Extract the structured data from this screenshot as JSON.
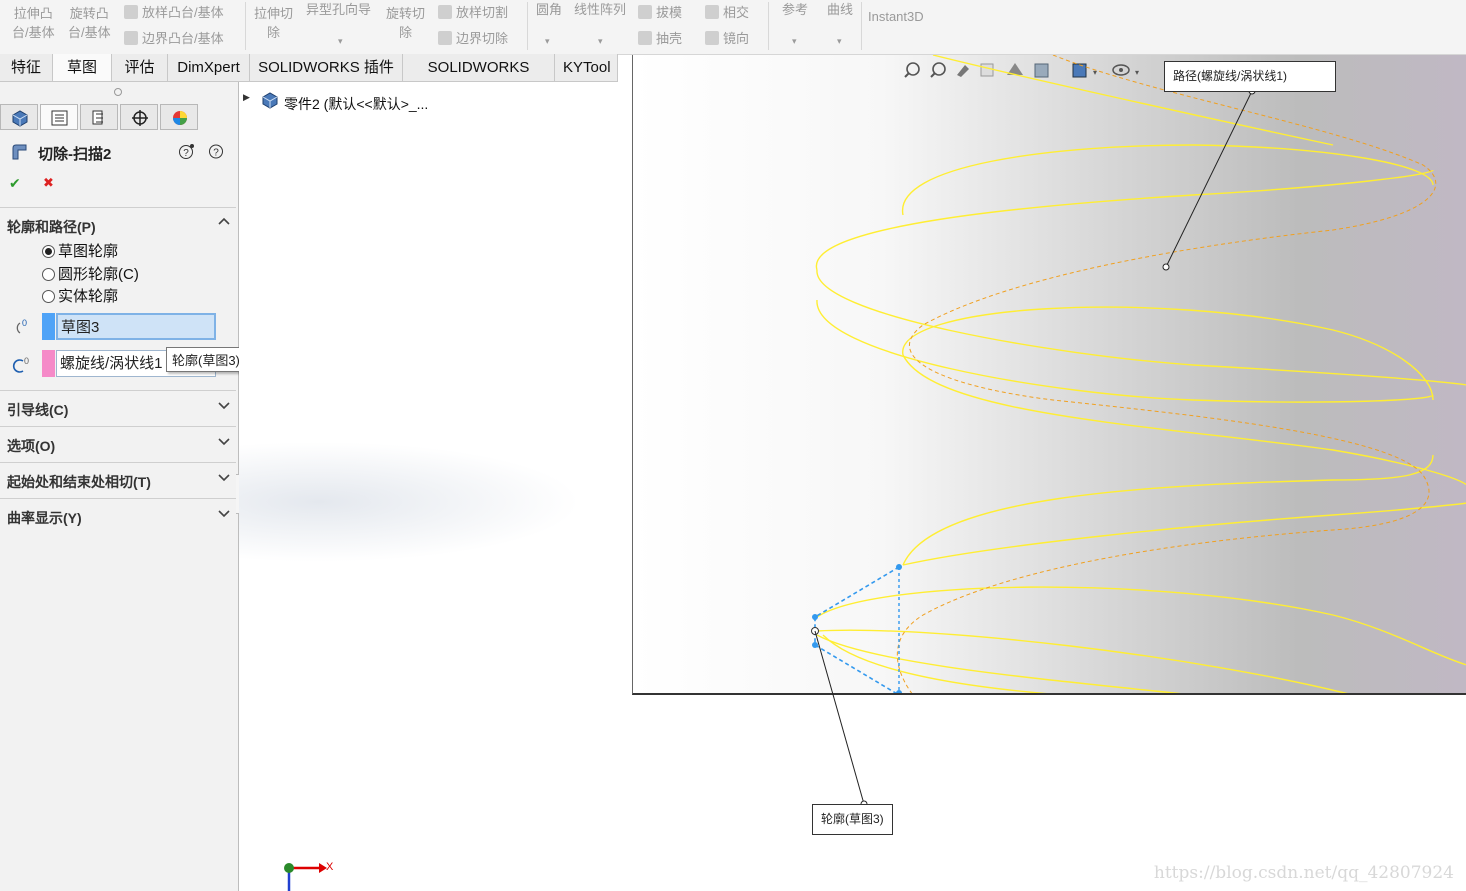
{
  "ribbon": {
    "extrude_boss_1": "拉伸凸",
    "extrude_boss_2": "台/基体",
    "revolve_boss_1": "旋转凸",
    "revolve_boss_2": "台/基体",
    "loft_boss": "放样凸台/基体",
    "boundary_boss": "边界凸台/基体",
    "extrude_cut_1": "拉伸切",
    "extrude_cut_2": "除",
    "hole_wizard": "异型孔向导",
    "revolve_cut_1": "旋转切",
    "revolve_cut_2": "除",
    "loft_cut": "放样切割",
    "boundary_cut": "边界切除",
    "fillet": "圆角",
    "linear_pattern": "线性阵列",
    "draft": "拔模",
    "shell": "抽壳",
    "intersect": "相交",
    "mirror": "镜向",
    "reference": "参考",
    "curves": "曲线",
    "instant3d": "Instant3D"
  },
  "tabs": [
    "特征",
    "草图",
    "评估",
    "DimXpert",
    "SOLIDWORKS 插件",
    "SOLIDWORKS MBD",
    "KYTool"
  ],
  "panel": {
    "feature_title": "切除-扫描2",
    "ok_symbol": "✔",
    "cancel_symbol": "✖",
    "section_profile_path": "轮廓和路径(P)",
    "radio_options": [
      "草图轮廓",
      "圆形轮廓(C)",
      "实体轮廓"
    ],
    "selected_radio": "草图轮廓",
    "profile_value": "草图3",
    "path_value": "螺旋线/涡状线1",
    "tooltip": "轮廓(草图3)",
    "collapsed_sections": [
      "引导线(C)",
      "选项(O)",
      "起始处和结束处相切(T)",
      "曲率显示(Y)"
    ]
  },
  "tree": {
    "root_label": "零件2 (默认<<默认>_..."
  },
  "viewport": {
    "callout_path": "路径(螺旋线/涡状线1)",
    "callout_profile": "轮廓(草图3)",
    "triad_x_label": "X",
    "helix_color": "#ffee33",
    "dashed_color": "#f0a020",
    "sketch_color": "#3399ee"
  },
  "watermark": "https://blog.csdn.net/qq_42807924",
  "icons": [
    "feature-manager-icon",
    "property-manager-icon",
    "configuration-manager-icon",
    "dimxpert-icon",
    "display-manager-icon",
    "sweep-cut-icon",
    "help-icon",
    "question-icon",
    "part-icon",
    "profile-icon",
    "path-icon"
  ]
}
